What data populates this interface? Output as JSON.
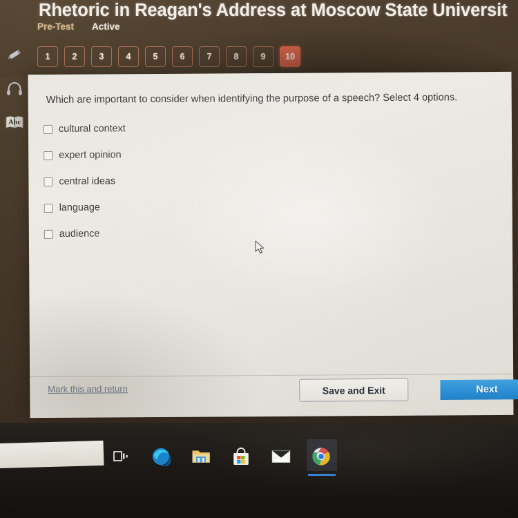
{
  "header": {
    "title": "Rhetoric in Reagan's Address at Moscow State Universit",
    "pretest_label": "Pre-Test",
    "status_label": "Active"
  },
  "question_nav": {
    "items": [
      "1",
      "2",
      "3",
      "4",
      "5",
      "6",
      "7",
      "8",
      "9",
      "10"
    ],
    "current": "10"
  },
  "question": {
    "prompt": "Which are important to consider when identifying the purpose of a speech? Select 4 options.",
    "options": [
      {
        "label": "cultural context",
        "checked": false
      },
      {
        "label": "expert opinion",
        "checked": false
      },
      {
        "label": "central ideas",
        "checked": false
      },
      {
        "label": "language",
        "checked": false
      },
      {
        "label": "audience",
        "checked": false
      }
    ]
  },
  "actions": {
    "mark_link": "Mark this and return",
    "save_exit": "Save and Exit",
    "next": "Next"
  },
  "sidebar": {
    "items": [
      {
        "icon": "pencil-icon",
        "name": "highlighter-tool"
      },
      {
        "icon": "headphones-icon",
        "name": "audio-tool"
      },
      {
        "icon": "dictionary-icon",
        "name": "dictionary-tool",
        "glyph": "Abc"
      }
    ]
  },
  "taskbar": {
    "search_placeholder": "",
    "items": [
      {
        "name": "task-view-icon"
      },
      {
        "name": "edge-icon"
      },
      {
        "name": "file-explorer-icon"
      },
      {
        "name": "microsoft-store-icon"
      },
      {
        "name": "mail-icon"
      },
      {
        "name": "chrome-icon",
        "active": true
      }
    ]
  },
  "colors": {
    "accent_current": "#e2674d",
    "next_button": "#2b8fd4",
    "link": "#6d7b8d",
    "pretest": "#d8b98a"
  }
}
